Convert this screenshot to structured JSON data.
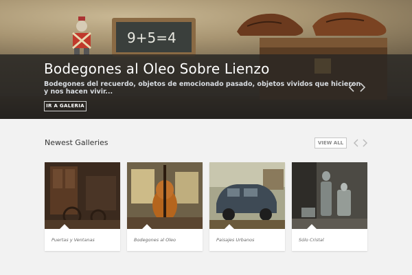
{
  "hero": {
    "title": "Bodegones al Oleo Sobre Lienzo",
    "subtitle": "Bodegones del recuerdo, objetos de emocionado pasado, objetos vividos que hicieron y nos hacen vivir...",
    "button_label": "IR A GALERIA",
    "slate_text": "9+5=4",
    "prev_icon": "chevron-left-icon",
    "next_icon": "chevron-right-icon"
  },
  "section": {
    "title": "Newest Galleries",
    "view_all_label": "VIEW ALL",
    "prev_icon": "chevron-left-icon",
    "next_icon": "chevron-right-icon"
  },
  "galleries": [
    {
      "label": "Puertas y Ventanas"
    },
    {
      "label": "Bodegones al Oleo"
    },
    {
      "label": "Paisajes Urbanos"
    },
    {
      "label": "Sólo Cristal"
    }
  ],
  "colors": {
    "page_bg": "#f2f2f2",
    "hero_band": "#232323",
    "title_text": "#ffffff",
    "subtitle_text": "#d9dde2",
    "card_bg": "#ffffff"
  }
}
